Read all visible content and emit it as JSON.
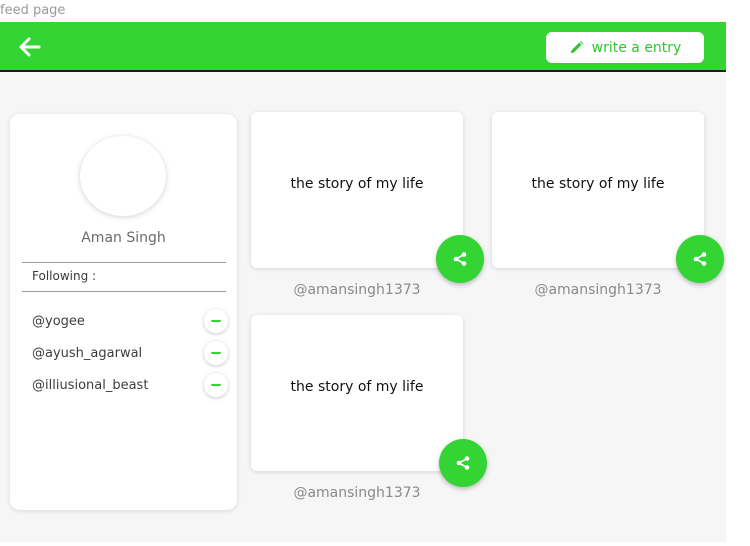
{
  "page_caption": "feed page",
  "header": {
    "back_icon": "arrow-left-icon",
    "write_label": "write a entry",
    "write_icon": "pencil-icon",
    "accent_color": "#33d433"
  },
  "profile": {
    "name": "Aman Singh",
    "following_label": "Following :",
    "following": [
      {
        "handle": "@yogee"
      },
      {
        "handle": "@ayush_agarwal"
      },
      {
        "handle": "@illiusional_beast"
      }
    ]
  },
  "entries": [
    {
      "title": "the story of my life",
      "author": "@amansingh1373"
    },
    {
      "title": "the story of my life",
      "author": "@amansingh1373"
    },
    {
      "title": "the story of my life",
      "author": "@amansingh1373"
    }
  ]
}
